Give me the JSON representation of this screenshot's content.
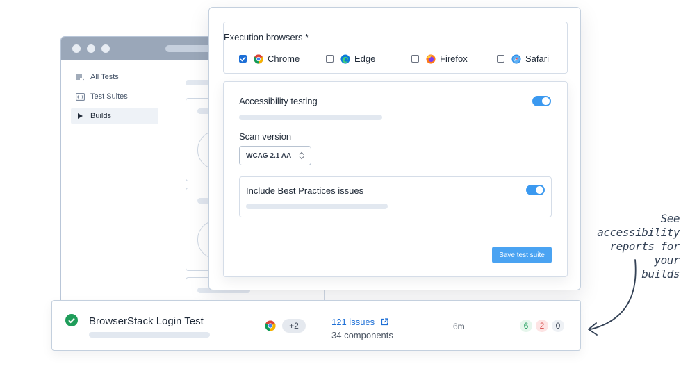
{
  "sidebar": {
    "items": [
      {
        "label": "All Tests",
        "icon": "list-icon"
      },
      {
        "label": "Test Suites",
        "icon": "code-icon"
      },
      {
        "label": "Builds",
        "icon": "play-icon",
        "active": true
      }
    ]
  },
  "modal": {
    "browsers_title": "Execution browsers *",
    "browsers": [
      {
        "label": "Chrome",
        "checked": true
      },
      {
        "label": "Edge",
        "checked": false
      },
      {
        "label": "Firefox",
        "checked": false
      },
      {
        "label": "Safari",
        "checked": false
      }
    ],
    "accessibility_label": "Accessibility testing",
    "accessibility_on": true,
    "scan_version_label": "Scan version",
    "scan_version_value": "WCAG 2.1 AA",
    "best_practices_label": "Include Best Practices issues",
    "best_practices_on": true,
    "save_label": "Save test suite"
  },
  "build": {
    "name": "BrowserStack Login Test",
    "status": "passed",
    "extra_browsers": "+2",
    "issues": "121 issues",
    "components": "34 components",
    "duration": "6m",
    "counts": {
      "passed": "6",
      "failed": "2",
      "skipped": "0"
    }
  },
  "annotation": {
    "line1": "See accessibility",
    "line2": "reports for your",
    "line3": "builds"
  },
  "colors": {
    "accent": "#3b99f0",
    "link": "#1d6fd6",
    "success": "#1f9d5a",
    "danger": "#d64545"
  }
}
